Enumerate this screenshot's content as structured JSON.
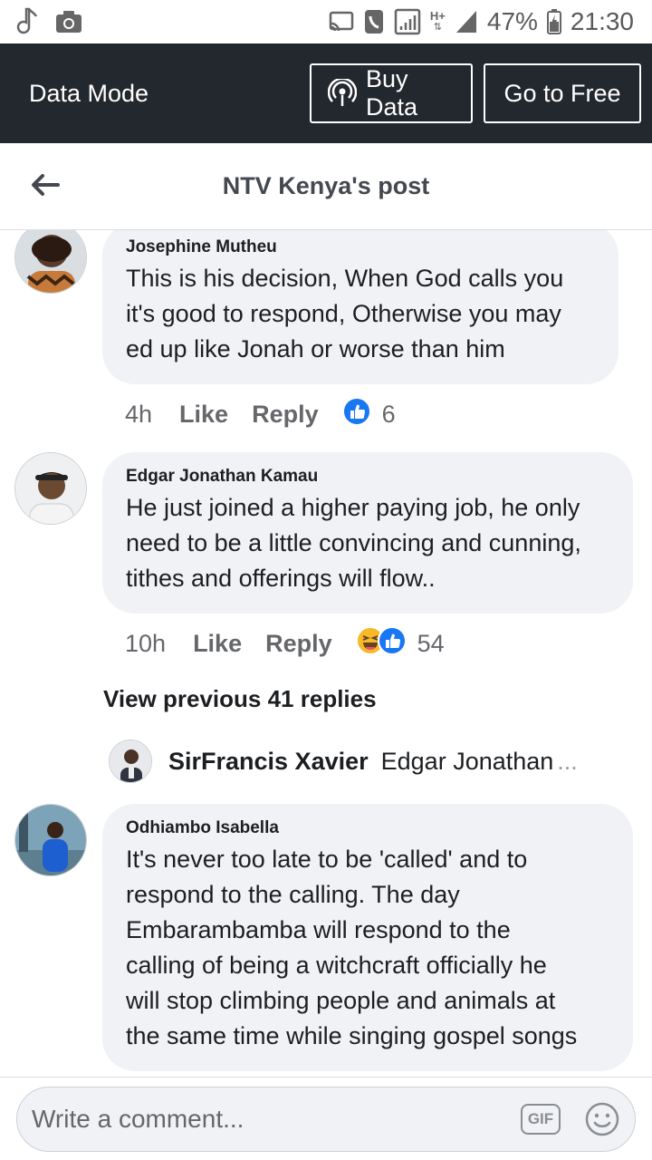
{
  "status_bar": {
    "battery": "47%",
    "time": "21:30",
    "network": "H+"
  },
  "banner": {
    "label": "Data Mode",
    "buy_data": "Buy Data",
    "go_free": "Go to Free"
  },
  "header": {
    "title": "NTV Kenya's post"
  },
  "comments": [
    {
      "author": "Josephine Mutheu",
      "lines": [
        "This  is his decision, When God calls you",
        "it's good to respond, Otherwise you may",
        "ed up like Jonah or  worse than him"
      ],
      "time": "4h",
      "like": "Like",
      "reply": "Reply",
      "reaction_count": "6"
    },
    {
      "author": "Edgar Jonathan Kamau",
      "lines": [
        "He just joined a higher paying job, he only",
        "need to be a little convincing and cunning,",
        "tithes and offerings will flow.."
      ],
      "time": "10h",
      "like": "Like",
      "reply": "Reply",
      "reaction_count": "54"
    },
    {
      "author": "Odhiambo Isabella",
      "lines": [
        "It's never too late to be 'called' and to",
        "respond to the calling. The day",
        "Embarambamba will respond to the",
        "calling of being a witchcraft officially he",
        "will stop climbing people and animals at",
        "the same time while singing gospel songs"
      ]
    }
  ],
  "view_previous": "View previous 41 replies",
  "reply_preview": {
    "author": "SirFrancis Xavier",
    "text": "Edgar Jonathan",
    "ellipsis": "..."
  },
  "composer": {
    "placeholder": "Write a comment...",
    "gif": "GIF"
  },
  "colors": {
    "banner_bg": "#23272e",
    "bubble_bg": "#f0f2f5",
    "like_blue": "#1877f2",
    "haha_yellow": "#f7b928"
  }
}
